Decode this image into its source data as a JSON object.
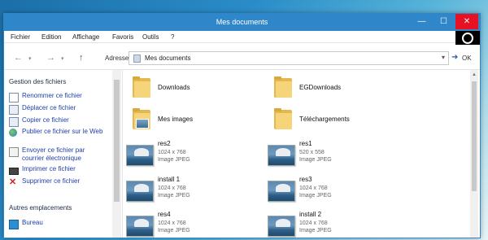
{
  "window": {
    "title": "Mes documents"
  },
  "title_buttons": {
    "minimize": "—",
    "maximize": "☐",
    "close": "✕"
  },
  "menu": [
    "Fichier",
    "Edition",
    "Affichage",
    "Favoris",
    "Outils",
    "?"
  ],
  "nav": {
    "back": "←",
    "forward": "→",
    "dropdown": "▾",
    "up": "↑"
  },
  "address": {
    "label": "Adresse",
    "value": "Mes documents",
    "dropdown": "▾",
    "go_label": "OK",
    "go_arrow": "➜"
  },
  "sidebar": {
    "section1_title": "Gestion des fichiers",
    "tasks": [
      {
        "label": "Renommer ce fichier",
        "icon": "rename-icon"
      },
      {
        "label": "Déplacer ce fichier",
        "icon": "move-icon"
      },
      {
        "label": "Copier ce fichier",
        "icon": "copy-icon"
      },
      {
        "label": "Publier ce fichier sur le Web",
        "icon": "globe-icon"
      },
      {
        "label": "Envoyer ce fichier par courrier électronique",
        "icon": "email-icon"
      },
      {
        "label": "Imprimer ce fichier",
        "icon": "printer-icon"
      },
      {
        "label": "Supprimer ce fichier",
        "icon": "delete-icon"
      }
    ],
    "section2_title": "Autres emplacements",
    "places": [
      {
        "label": "Bureau",
        "icon": "desktop-icon"
      }
    ]
  },
  "items": [
    {
      "name": "Downloads",
      "kind": "folder"
    },
    {
      "name": "EGDownloads",
      "kind": "folder"
    },
    {
      "name": "Mes images",
      "kind": "folder-pictures"
    },
    {
      "name": "Téléchargements",
      "kind": "folder"
    },
    {
      "name": "res2",
      "dims": "1024 x 768",
      "type": "Image JPEG"
    },
    {
      "name": "res1",
      "dims": "520 x 558",
      "type": "Image JPEG"
    },
    {
      "name": "install 1",
      "dims": "1024 x 768",
      "type": "Image JPEG"
    },
    {
      "name": "res3",
      "dims": "1024 x 768",
      "type": "Image JPEG"
    },
    {
      "name": "res4",
      "dims": "1024 x 768",
      "type": "Image JPEG"
    },
    {
      "name": "install 2",
      "dims": "1024 x 768",
      "type": "Image JPEG"
    }
  ],
  "colors": {
    "titlebar": "#2f86c9",
    "close": "#e81123",
    "folder": "#f6d57a",
    "link": "#1f3fa8"
  }
}
